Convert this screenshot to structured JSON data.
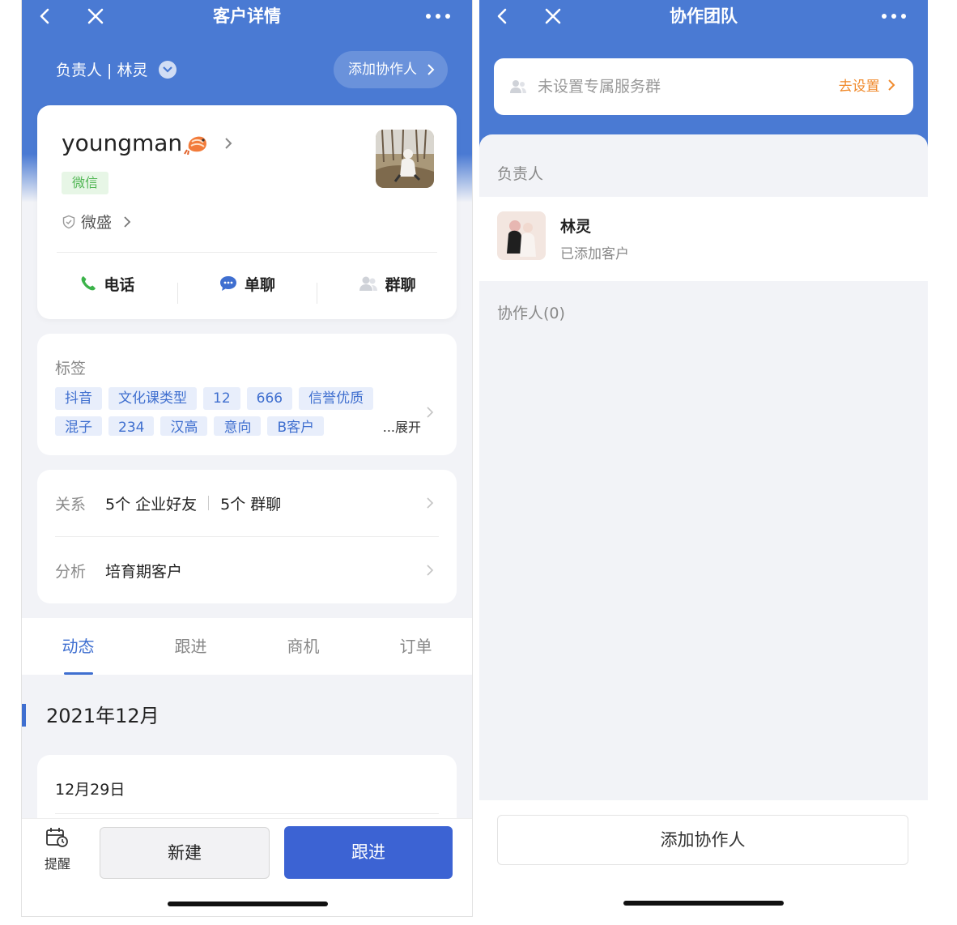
{
  "left": {
    "nav": {
      "title": "客户详情"
    },
    "owner": {
      "label": "负责人 | 林灵",
      "add_collaborator": "添加协作人"
    },
    "profile": {
      "nickname": "youngman",
      "channel_badge": "微信",
      "company": "微盛",
      "actions": [
        {
          "label": "电话",
          "icon": "phone-icon"
        },
        {
          "label": "单聊",
          "icon": "chat-bubble-icon"
        },
        {
          "label": "群聊",
          "icon": "group-icon"
        }
      ]
    },
    "tags": {
      "title": "标签",
      "row1": [
        "抖音",
        "文化课类型",
        "12",
        "666",
        "信誉优质"
      ],
      "row2": [
        "混子",
        "234",
        "汉高",
        "意向",
        "B客户"
      ],
      "expand": "...展开"
    },
    "relation": {
      "label": "关系",
      "friends": "5个 企业好友",
      "groups": "5个 群聊",
      "analysis_label": "分析",
      "analysis_value": "培育期客户"
    },
    "tabs": [
      "动态",
      "跟进",
      "商机",
      "订单"
    ],
    "active_tab": "动态",
    "timeline": {
      "month": "2021年12月",
      "date": "12月29日"
    },
    "bottom": {
      "remind": "提醒",
      "new_label": "新建",
      "follow_label": "跟进"
    },
    "colors": {
      "primary": "#4a7ad3",
      "button": "#3c63d3",
      "tag_text": "#3f6fcf",
      "wechat_green": "#53b756"
    }
  },
  "right": {
    "nav": {
      "title": "协作团队"
    },
    "group": {
      "text": "未设置专属服务群",
      "link": "去设置"
    },
    "owner_section": "负责人",
    "owner": {
      "name": "林灵",
      "status": "已添加客户"
    },
    "collaborator_section": "协作人(0)",
    "add_button": "添加协作人",
    "colors": {
      "link_orange": "#f08a2c"
    }
  }
}
